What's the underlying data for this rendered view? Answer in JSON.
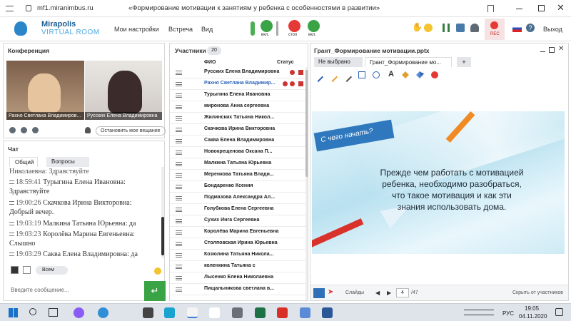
{
  "browser": {
    "url": "mf1.miranimbus.ru",
    "title": "«Формирование мотивации к занятиям у ребенка с особенностями в развитии»"
  },
  "header": {
    "logo_line1": "Mirapolis",
    "logo_line2": "VIRTUAL ROOM",
    "menu": [
      "Мои настройки",
      "Встреча",
      "Вид"
    ],
    "mic_label": "вкл.",
    "stop_label": "стоп",
    "cam_label": "вкл.",
    "rec_label": "REC",
    "exit_label": "Выход"
  },
  "conference": {
    "title": "Конференция",
    "video1_name": "Рахно Светлана  Владимиров...",
    "video2_name": "Русских Елена Владимировна",
    "stop_button": "Остановить мое вещание"
  },
  "chat": {
    "title": "Чат",
    "tabs": [
      "Общий",
      "Вопросы"
    ],
    "messages": [
      {
        "time": "",
        "name": "Николаевна:",
        "text": "Здравствуйте"
      },
      {
        "time": "18:59:41",
        "name": "Турыгина  Елена  Ивановна:",
        "text": ""
      },
      {
        "time": "",
        "name": "",
        "text": "Здравствуйте"
      },
      {
        "time": "19:00:26",
        "name": "Скачкова  Ирина Викторовна:",
        "text": ""
      },
      {
        "time": "",
        "name": "",
        "text": "Добрый вечер."
      },
      {
        "time": "19:03:19",
        "name": "Малкина Татьяна  Юрьевна:",
        "text": "да"
      },
      {
        "time": "19:03:23",
        "name": "Королёва Марина Евгеньевна:",
        "text": ""
      },
      {
        "time": "",
        "name": "",
        "text": "Слышно"
      },
      {
        "time": "19:03:29",
        "name": "Саква Елена Владимировна:",
        "text": "да"
      }
    ],
    "recipient": "Всем",
    "input_placeholder": "Введите сообщение..."
  },
  "participants": {
    "title": "Участники",
    "count": "20",
    "col_fio": "ФИО",
    "col_status": "Статус",
    "list": [
      "Русских Елена Владимировна",
      "Рахно Светлана  Владимир...",
      "Турыгина  Елена  Ивановна",
      "миронова  Анна  сергеевна",
      "Жилинских Татьяна Никол...",
      "Скачкова  Ирина Викторовна",
      "Саква Елена Владимировна",
      "Новокрещенова  Оксана  П...",
      "Малкина Татьяна  Юрьевна",
      "Меренкова Татьяна  Влади...",
      "Бондаренко  Ксения",
      "Подмазова Александра  Ал...",
      "Голубкова  Елена Сергеевна",
      "Сухих  Инга Сергеевна",
      "Королёва Марина Евгеньевна",
      "Столповская Ирина Юрьевна",
      "Козюлина Татьяна Никола...",
      "коленкина Татьяна  с",
      "Лысенко Елена  Николаевна",
      "Пищальникова  светлана в..."
    ]
  },
  "presentation": {
    "title": "Грант_Формирование мотивации.pptx",
    "tabs": [
      "Не выбрано",
      "Грант_Формирование мо...",
      "+"
    ],
    "slide_heading": "С чего начать?",
    "slide_text": [
      "Прежде чем работать с мотивацией",
      "ребенка, необходимо разобраться,",
      "что такое мотивация и как эти",
      "знания использовать дома."
    ],
    "slides_label": "Слайды",
    "page": "4",
    "total": "/47",
    "hide_label": "Скрыть от участников"
  },
  "taskbar": {
    "lang": "РУС",
    "time": "19:05",
    "date": "04.11.2020"
  }
}
